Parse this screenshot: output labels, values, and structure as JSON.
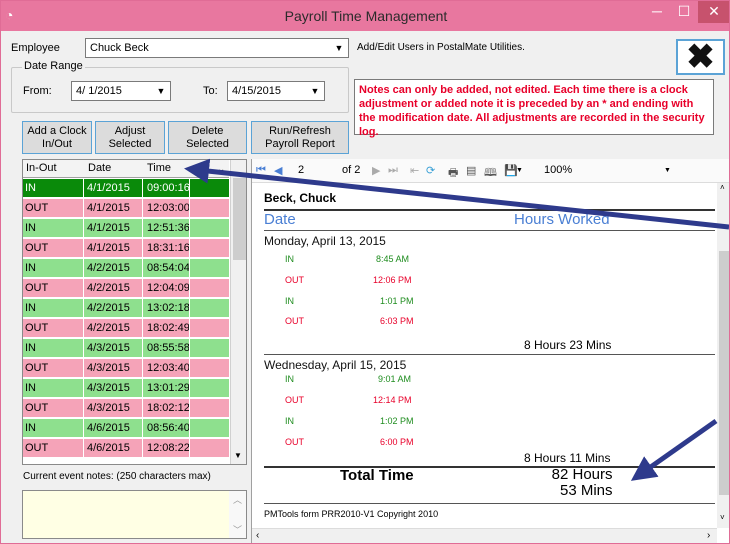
{
  "window": {
    "title": "Payroll Time Management",
    "minimize": "─",
    "maximize": "☐",
    "close": "✕"
  },
  "employee": {
    "label": "Employee",
    "value": "Chuck Beck",
    "hint": "Add/Edit Users in PostalMate Utilities."
  },
  "date_range": {
    "label": "Date Range",
    "from_label": "From:",
    "from_value": "4/ 1/2015",
    "to_label": "To:",
    "to_value": "4/15/2015"
  },
  "notice": "Notes can only be added, not edited. Each time there is a clock adjustment or added note it is preceded by an * and ending with the modification date.  All adjustments are recorded in the security log.",
  "buttons": {
    "add": "Add a Clock In/Out",
    "adjust": "Adjust Selected",
    "delete": "Delete Selected",
    "run": "Run/Refresh Payroll Report"
  },
  "grid": {
    "headers": [
      "In-Out",
      "Date",
      "Time",
      "..."
    ],
    "rows": [
      {
        "type": "IN",
        "date": "4/1/2015",
        "time": "09:00:16",
        "selected": true
      },
      {
        "type": "OUT",
        "date": "4/1/2015",
        "time": "12:03:00"
      },
      {
        "type": "IN",
        "date": "4/1/2015",
        "time": "12:51:36"
      },
      {
        "type": "OUT",
        "date": "4/1/2015",
        "time": "18:31:16"
      },
      {
        "type": "IN",
        "date": "4/2/2015",
        "time": "08:54:04"
      },
      {
        "type": "OUT",
        "date": "4/2/2015",
        "time": "12:04:09"
      },
      {
        "type": "IN",
        "date": "4/2/2015",
        "time": "13:02:18"
      },
      {
        "type": "OUT",
        "date": "4/2/2015",
        "time": "18:02:49"
      },
      {
        "type": "IN",
        "date": "4/3/2015",
        "time": "08:55:58"
      },
      {
        "type": "OUT",
        "date": "4/3/2015",
        "time": "12:03:40"
      },
      {
        "type": "IN",
        "date": "4/3/2015",
        "time": "13:01:29"
      },
      {
        "type": "OUT",
        "date": "4/3/2015",
        "time": "18:02:12"
      },
      {
        "type": "IN",
        "date": "4/6/2015",
        "time": "08:56:40"
      },
      {
        "type": "OUT",
        "date": "4/6/2015",
        "time": "12:08:22"
      }
    ]
  },
  "notes": {
    "label": "Current event notes: (250 characters max)"
  },
  "toolbar": {
    "page": "2",
    "of": "of 2",
    "zoom": "100%"
  },
  "report": {
    "employee": "Beck, Chuck",
    "col_date": "Date",
    "col_hours": "Hours Worked",
    "day1": {
      "label": "Monday, April 13, 2015",
      "punches": [
        {
          "type": "IN",
          "time": "8:45 AM"
        },
        {
          "type": "OUT",
          "time": "12:06 PM"
        },
        {
          "type": "IN",
          "time": "1:01 PM"
        },
        {
          "type": "OUT",
          "time": "6:03 PM"
        }
      ],
      "subtotal": "8 Hours 23 Mins"
    },
    "day2": {
      "label": "Wednesday, April 15, 2015",
      "punches": [
        {
          "type": "IN",
          "time": "9:01 AM"
        },
        {
          "type": "OUT",
          "time": "12:14 PM"
        },
        {
          "type": "IN",
          "time": "1:02 PM"
        },
        {
          "type": "OUT",
          "time": "6:00 PM"
        }
      ],
      "subtotal": "8 Hours 11 Mins"
    },
    "total_label": "Total Time",
    "total_hours": "82 Hours",
    "total_mins": "53 Mins",
    "copyright": "PMTools form PRR2010-V1 Copyright 2010"
  },
  "colors": {
    "in_row": "#8ee08e",
    "out_row": "#f5a3b8",
    "selected_row": "#0a8a0a",
    "arrow": "#2e3a8c",
    "title_bar": "#e8779f"
  }
}
